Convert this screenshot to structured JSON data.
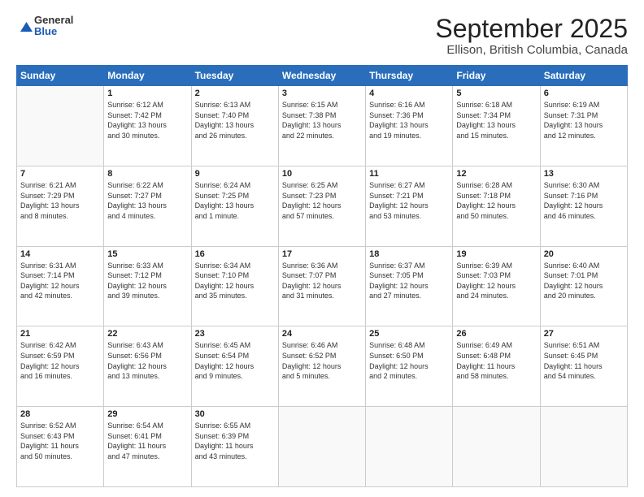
{
  "header": {
    "logo": {
      "line1": "General",
      "line2": "Blue"
    },
    "title": "September 2025",
    "subtitle": "Ellison, British Columbia, Canada"
  },
  "calendar": {
    "days_of_week": [
      "Sunday",
      "Monday",
      "Tuesday",
      "Wednesday",
      "Thursday",
      "Friday",
      "Saturday"
    ],
    "weeks": [
      [
        {
          "day": "",
          "info": ""
        },
        {
          "day": "1",
          "info": "Sunrise: 6:12 AM\nSunset: 7:42 PM\nDaylight: 13 hours\nand 30 minutes."
        },
        {
          "day": "2",
          "info": "Sunrise: 6:13 AM\nSunset: 7:40 PM\nDaylight: 13 hours\nand 26 minutes."
        },
        {
          "day": "3",
          "info": "Sunrise: 6:15 AM\nSunset: 7:38 PM\nDaylight: 13 hours\nand 22 minutes."
        },
        {
          "day": "4",
          "info": "Sunrise: 6:16 AM\nSunset: 7:36 PM\nDaylight: 13 hours\nand 19 minutes."
        },
        {
          "day": "5",
          "info": "Sunrise: 6:18 AM\nSunset: 7:34 PM\nDaylight: 13 hours\nand 15 minutes."
        },
        {
          "day": "6",
          "info": "Sunrise: 6:19 AM\nSunset: 7:31 PM\nDaylight: 13 hours\nand 12 minutes."
        }
      ],
      [
        {
          "day": "7",
          "info": "Sunrise: 6:21 AM\nSunset: 7:29 PM\nDaylight: 13 hours\nand 8 minutes."
        },
        {
          "day": "8",
          "info": "Sunrise: 6:22 AM\nSunset: 7:27 PM\nDaylight: 13 hours\nand 4 minutes."
        },
        {
          "day": "9",
          "info": "Sunrise: 6:24 AM\nSunset: 7:25 PM\nDaylight: 13 hours\nand 1 minute."
        },
        {
          "day": "10",
          "info": "Sunrise: 6:25 AM\nSunset: 7:23 PM\nDaylight: 12 hours\nand 57 minutes."
        },
        {
          "day": "11",
          "info": "Sunrise: 6:27 AM\nSunset: 7:21 PM\nDaylight: 12 hours\nand 53 minutes."
        },
        {
          "day": "12",
          "info": "Sunrise: 6:28 AM\nSunset: 7:18 PM\nDaylight: 12 hours\nand 50 minutes."
        },
        {
          "day": "13",
          "info": "Sunrise: 6:30 AM\nSunset: 7:16 PM\nDaylight: 12 hours\nand 46 minutes."
        }
      ],
      [
        {
          "day": "14",
          "info": "Sunrise: 6:31 AM\nSunset: 7:14 PM\nDaylight: 12 hours\nand 42 minutes."
        },
        {
          "day": "15",
          "info": "Sunrise: 6:33 AM\nSunset: 7:12 PM\nDaylight: 12 hours\nand 39 minutes."
        },
        {
          "day": "16",
          "info": "Sunrise: 6:34 AM\nSunset: 7:10 PM\nDaylight: 12 hours\nand 35 minutes."
        },
        {
          "day": "17",
          "info": "Sunrise: 6:36 AM\nSunset: 7:07 PM\nDaylight: 12 hours\nand 31 minutes."
        },
        {
          "day": "18",
          "info": "Sunrise: 6:37 AM\nSunset: 7:05 PM\nDaylight: 12 hours\nand 27 minutes."
        },
        {
          "day": "19",
          "info": "Sunrise: 6:39 AM\nSunset: 7:03 PM\nDaylight: 12 hours\nand 24 minutes."
        },
        {
          "day": "20",
          "info": "Sunrise: 6:40 AM\nSunset: 7:01 PM\nDaylight: 12 hours\nand 20 minutes."
        }
      ],
      [
        {
          "day": "21",
          "info": "Sunrise: 6:42 AM\nSunset: 6:59 PM\nDaylight: 12 hours\nand 16 minutes."
        },
        {
          "day": "22",
          "info": "Sunrise: 6:43 AM\nSunset: 6:56 PM\nDaylight: 12 hours\nand 13 minutes."
        },
        {
          "day": "23",
          "info": "Sunrise: 6:45 AM\nSunset: 6:54 PM\nDaylight: 12 hours\nand 9 minutes."
        },
        {
          "day": "24",
          "info": "Sunrise: 6:46 AM\nSunset: 6:52 PM\nDaylight: 12 hours\nand 5 minutes."
        },
        {
          "day": "25",
          "info": "Sunrise: 6:48 AM\nSunset: 6:50 PM\nDaylight: 12 hours\nand 2 minutes."
        },
        {
          "day": "26",
          "info": "Sunrise: 6:49 AM\nSunset: 6:48 PM\nDaylight: 11 hours\nand 58 minutes."
        },
        {
          "day": "27",
          "info": "Sunrise: 6:51 AM\nSunset: 6:45 PM\nDaylight: 11 hours\nand 54 minutes."
        }
      ],
      [
        {
          "day": "28",
          "info": "Sunrise: 6:52 AM\nSunset: 6:43 PM\nDaylight: 11 hours\nand 50 minutes."
        },
        {
          "day": "29",
          "info": "Sunrise: 6:54 AM\nSunset: 6:41 PM\nDaylight: 11 hours\nand 47 minutes."
        },
        {
          "day": "30",
          "info": "Sunrise: 6:55 AM\nSunset: 6:39 PM\nDaylight: 11 hours\nand 43 minutes."
        },
        {
          "day": "",
          "info": ""
        },
        {
          "day": "",
          "info": ""
        },
        {
          "day": "",
          "info": ""
        },
        {
          "day": "",
          "info": ""
        }
      ]
    ]
  }
}
